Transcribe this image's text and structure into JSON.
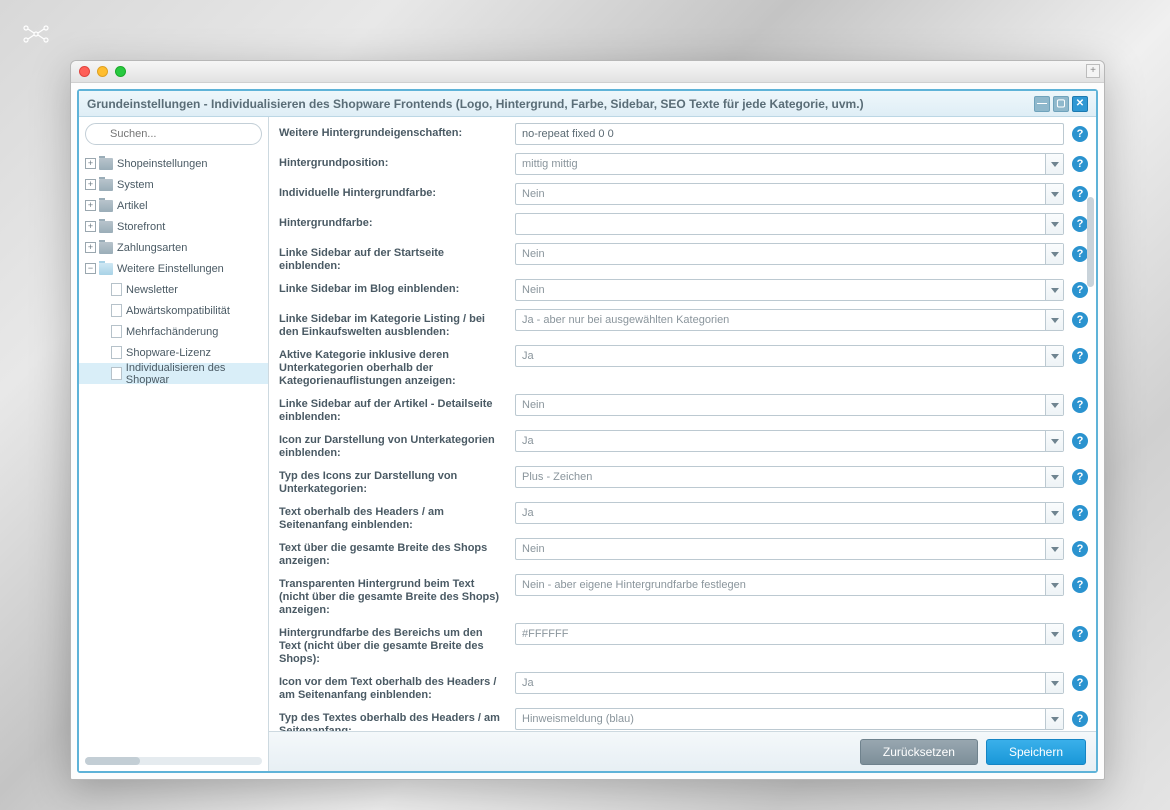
{
  "window_title": "Grundeinstellungen - Individualisieren des Shopware Frontends (Logo, Hintergrund, Farbe, Sidebar, SEO Texte für jede Kategorie, uvm.)",
  "search_placeholder": "Suchen...",
  "sidebar": {
    "items": [
      {
        "label": "Shopeinstellungen",
        "type": "folder-closed",
        "expand": "+"
      },
      {
        "label": "System",
        "type": "folder-closed",
        "expand": "+"
      },
      {
        "label": "Artikel",
        "type": "folder-closed",
        "expand": "+"
      },
      {
        "label": "Storefront",
        "type": "folder-closed",
        "expand": "+"
      },
      {
        "label": "Zahlungsarten",
        "type": "folder-closed",
        "expand": "+"
      },
      {
        "label": "Weitere Einstellungen",
        "type": "folder-open",
        "expand": "−"
      }
    ],
    "children": [
      {
        "label": "Newsletter"
      },
      {
        "label": "Abwärtskompatibilität"
      },
      {
        "label": "Mehrfachänderung"
      },
      {
        "label": "Shopware-Lizenz"
      },
      {
        "label": "Individualisieren des Shopwar"
      }
    ]
  },
  "fields": [
    {
      "label": "Weitere Hintergrundeigenschaften:",
      "value": "no-repeat fixed 0 0",
      "type": "input"
    },
    {
      "label": "Hintergrundposition:",
      "value": "mittig mittig",
      "type": "combo"
    },
    {
      "label": "Individuelle Hintergrundfarbe:",
      "value": "Nein",
      "type": "combo"
    },
    {
      "label": "Hintergrundfarbe:",
      "value": "",
      "type": "combo"
    },
    {
      "label": "Linke Sidebar auf der Startseite einblenden:",
      "value": "Nein",
      "type": "combo"
    },
    {
      "label": "Linke Sidebar im Blog einblenden:",
      "value": "Nein",
      "type": "combo"
    },
    {
      "label": "Linke Sidebar im Kategorie Listing / bei den Einkaufswelten ausblenden:",
      "value": "Ja - aber nur bei ausgewählten Kategorien",
      "type": "combo"
    },
    {
      "label": "Aktive Kategorie inklusive deren Unterkategorien oberhalb der Kategorienauflistungen anzeigen:",
      "value": "Ja",
      "type": "combo"
    },
    {
      "label": "Linke Sidebar auf der Artikel - Detailseite einblenden:",
      "value": "Nein",
      "type": "combo"
    },
    {
      "label": "Icon zur Darstellung von Unterkategorien einblenden:",
      "value": "Ja",
      "type": "combo"
    },
    {
      "label": "Typ des Icons zur Darstellung von Unterkategorien:",
      "value": "Plus - Zeichen",
      "type": "combo"
    },
    {
      "label": "Text oberhalb des Headers / am Seitenanfang einblenden:",
      "value": "Ja",
      "type": "combo"
    },
    {
      "label": "Text über die gesamte Breite des Shops anzeigen:",
      "value": "Nein",
      "type": "combo"
    },
    {
      "label": "Transparenten Hintergrund beim Text (nicht über die gesamte Breite des Shops) anzeigen:",
      "value": "Nein - aber eigene Hintergrundfarbe festlegen",
      "type": "combo"
    },
    {
      "label": "Hintergrundfarbe des Bereichs um den Text (nicht über die gesamte Breite des Shops):",
      "value": "#FFFFFF",
      "type": "combo"
    },
    {
      "label": "Icon vor dem Text oberhalb des Headers / am Seitenanfang einblenden:",
      "value": "Ja",
      "type": "combo"
    },
    {
      "label": "Typ des Textes oberhalb des Headers / am Seitenanfang:",
      "value": "Hinweismeldung (blau)",
      "type": "combo"
    }
  ],
  "buttons": {
    "reset": "Zurücksetzen",
    "save": "Speichern"
  }
}
